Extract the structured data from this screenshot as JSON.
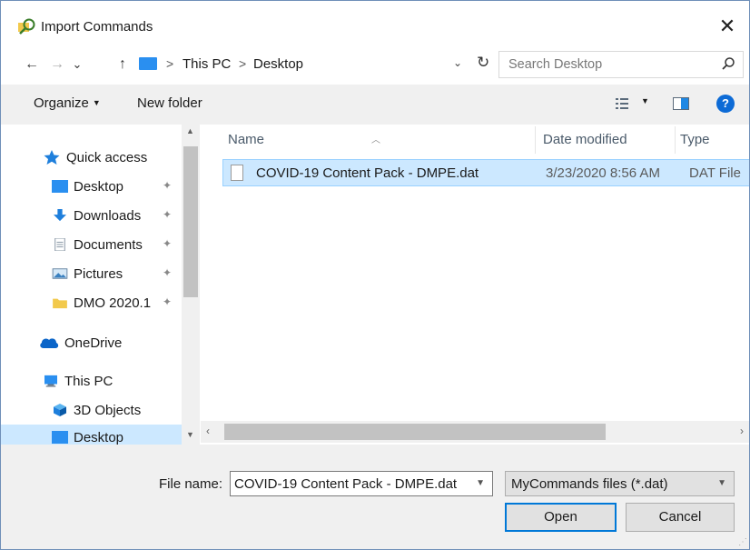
{
  "window": {
    "title": "Import Commands",
    "close_glyph": "✕"
  },
  "nav": {
    "back_glyph": "←",
    "forward_glyph": "→",
    "recent_glyph": "⌄",
    "up_glyph": "↑",
    "address": [
      "This PC",
      "Desktop"
    ],
    "address_sep": ">",
    "address_drop": "⌄",
    "refresh_glyph": "↻",
    "search_placeholder": "Search Desktop"
  },
  "toolbar": {
    "organize": "Organize",
    "new_folder": "New folder",
    "help": "?"
  },
  "sidebar": {
    "quick_access": "Quick access",
    "items": [
      {
        "label": "Desktop",
        "pinned": true
      },
      {
        "label": "Downloads",
        "pinned": true
      },
      {
        "label": "Documents",
        "pinned": true
      },
      {
        "label": "Pictures",
        "pinned": true
      },
      {
        "label": "DMO 2020.1",
        "pinned": true
      }
    ],
    "onedrive": "OneDrive",
    "this_pc": "This PC",
    "pc_items": [
      {
        "label": "3D Objects"
      },
      {
        "label": "Desktop"
      }
    ],
    "pin_glyph": "📌"
  },
  "columns": {
    "name": "Name",
    "date": "Date modified",
    "type": "Type"
  },
  "files": [
    {
      "name": "COVID-19 Content Pack - DMPE.dat",
      "date": "3/23/2020 8:56 AM",
      "type": "DAT File"
    }
  ],
  "bottom": {
    "file_name_label": "File name:",
    "file_name_value": "COVID-19 Content Pack - DMPE.dat",
    "file_type_value": "MyCommands files (*.dat)",
    "open": "Open",
    "cancel": "Cancel"
  },
  "colors": {
    "accent": "#0078d7",
    "selection": "#cce8ff",
    "folder_blue": "#2a8ff0"
  }
}
